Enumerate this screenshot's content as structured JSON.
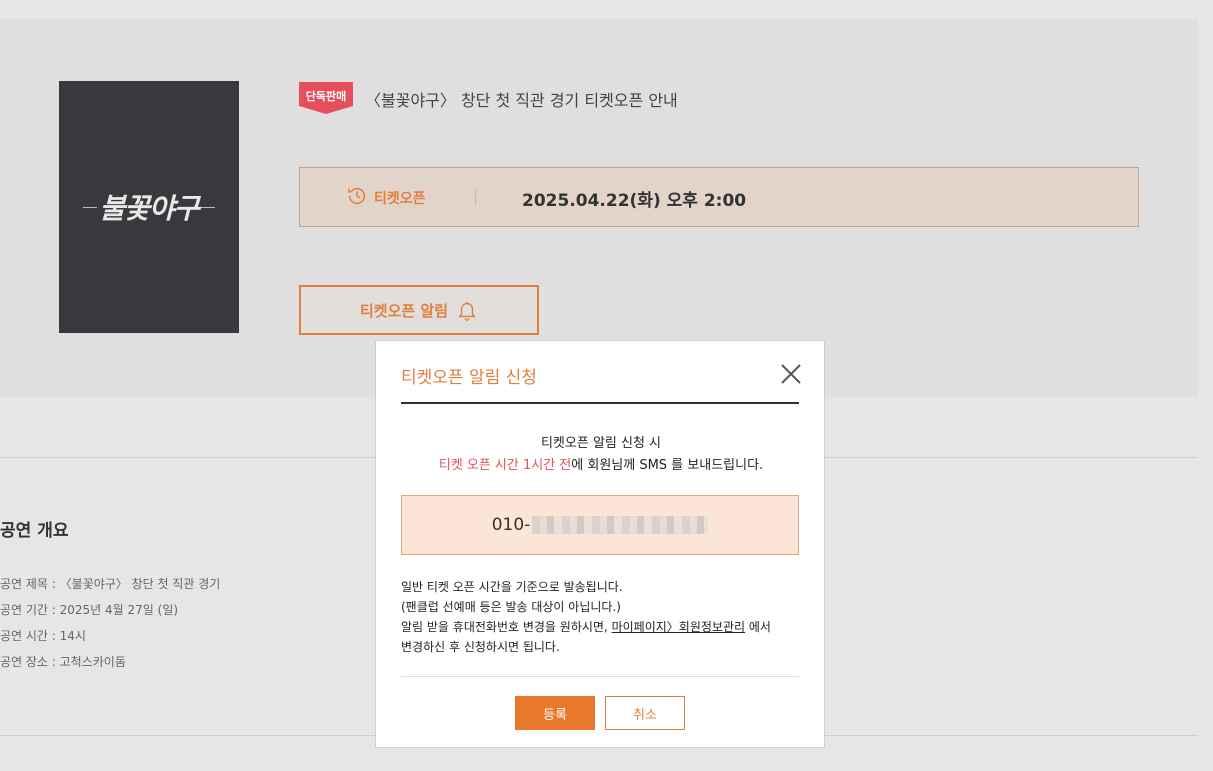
{
  "event": {
    "poster_logo": "불꽃야구",
    "badge": "단독판매",
    "title": "〈불꽃야구〉 창단 첫 직관 경기 티켓오픈 안내",
    "open_label": "티켓오픈",
    "open_date": "2025.04.22(화) 오후 2:00",
    "notify_button": "티켓오픈 알림"
  },
  "overview": {
    "title": "공연 개요",
    "lines": [
      "공연 제목 : 〈불꽃야구〉 창단 첫 직관 경기",
      "공연 기간 : 2025년 4월 27일 (일)",
      "공연 시간 : 14시",
      "공연 장소 : 고척스카이돔"
    ]
  },
  "modal": {
    "title": "티켓오픈 알림 신청",
    "msg_line1": "티켓오픈 알림 신청 시",
    "msg_accent": "티켓 오픈 시간 1시간 전",
    "msg_rest": "에 회원님께 SMS 를 보내드립니다.",
    "phone_prefix": "010-",
    "note1": "일반 티켓 오픈 시간을 기준으로 발송됩니다.",
    "note2": "(팬클럽 선예매 등은 발송 대상이 아닙니다.)",
    "note3_pre": "알림 받을 휴대전화번호 변경을 원하시면, ",
    "note3_link": "마이페이지〉회원정보관리",
    "note3_post": " 에서",
    "note4": "변경하신 후 신청하시면 됩니다.",
    "register": "등록",
    "cancel": "취소"
  },
  "colors": {
    "accent": "#e07f3d",
    "badge": "#e64e5c",
    "register_bg": "#e8782c"
  },
  "icons": [
    "clock-history-icon",
    "bell-icon",
    "close-icon"
  ]
}
